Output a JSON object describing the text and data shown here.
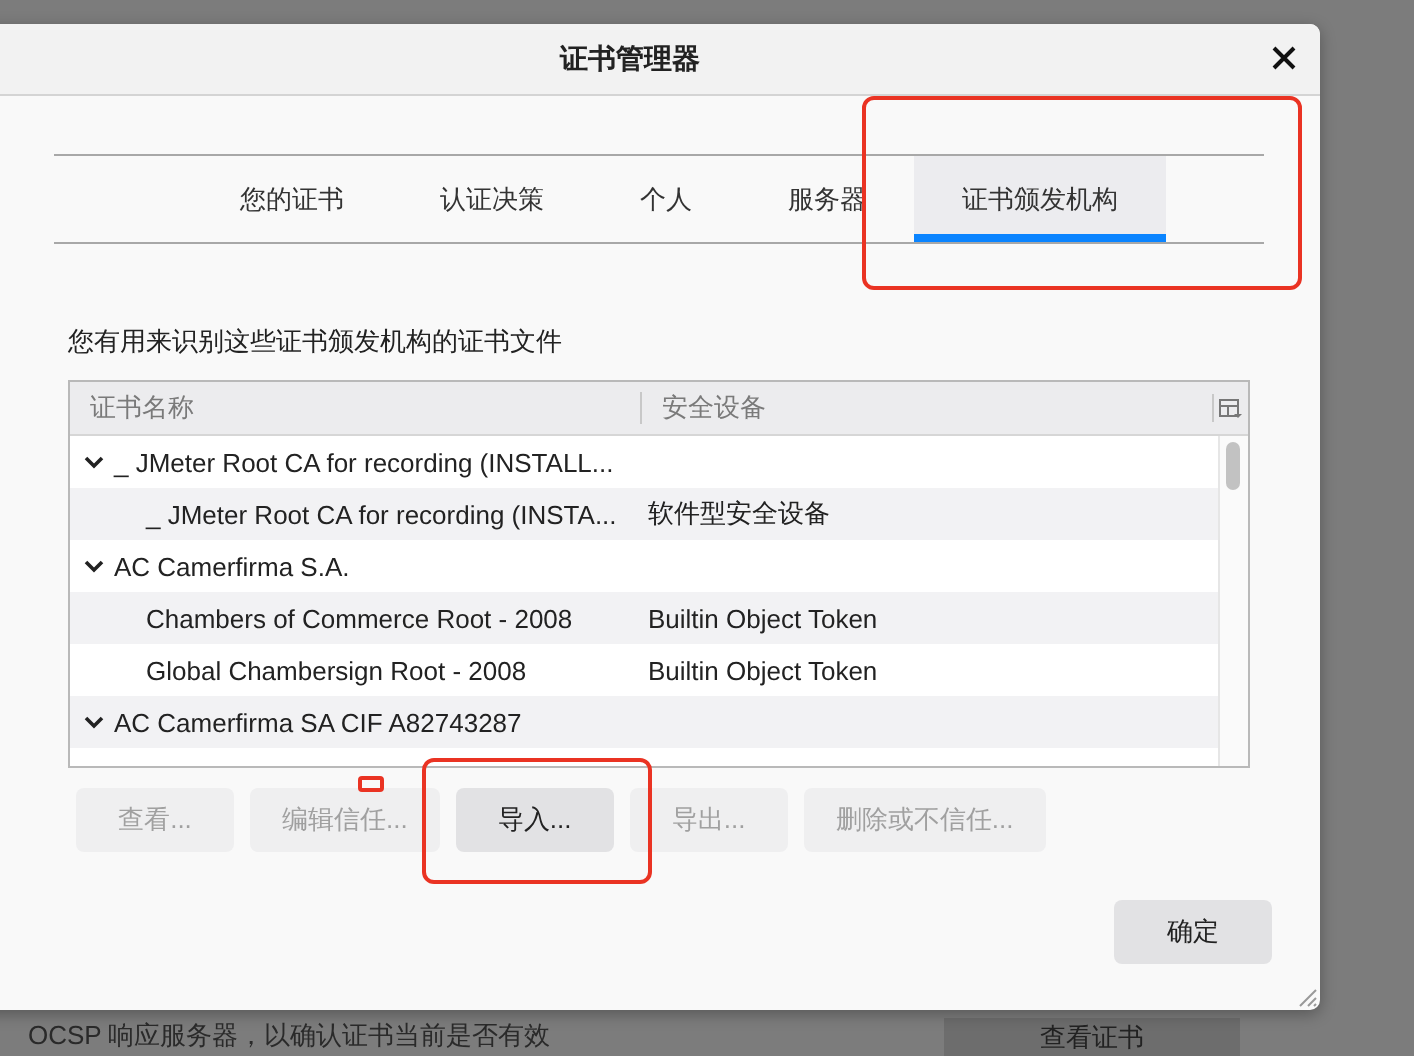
{
  "background": {
    "bottom_text": "OCSP 响应服务器，以确认证书当前是否有效",
    "bottom_button": "查看证书"
  },
  "window": {
    "title": "证书管理器"
  },
  "tabs": [
    {
      "label": "您的证书",
      "selected": false
    },
    {
      "label": "认证决策",
      "selected": false
    },
    {
      "label": "个人",
      "selected": false
    },
    {
      "label": "服务器",
      "selected": false
    },
    {
      "label": "证书颁发机构",
      "selected": true,
      "annotated": true
    }
  ],
  "description": "您有用来识别这些证书颁发机构的证书文件",
  "tree": {
    "columns": [
      "证书名称",
      "安全设备"
    ],
    "rows": [
      {
        "name": "_ JMeter Root CA for recording (INSTALL...",
        "expanded": true,
        "children": [
          {
            "name": "_ JMeter Root CA for recording (INSTA...",
            "device": "软件型安全设备"
          }
        ]
      },
      {
        "name": "AC Camerfirma S.A.",
        "expanded": true,
        "children": [
          {
            "name": "Chambers of Commerce Root - 2008",
            "device": "Builtin Object Token"
          },
          {
            "name": "Global Chambersign Root - 2008",
            "device": "Builtin Object Token"
          }
        ]
      },
      {
        "name": "AC Camerfirma SA CIF A82743287",
        "expanded": true,
        "children": []
      }
    ]
  },
  "buttons": [
    {
      "label": "查看...",
      "disabled": true
    },
    {
      "label": "编辑信任...",
      "disabled": true,
      "marker": true
    },
    {
      "label": "导入...",
      "disabled": false,
      "annotated": true
    },
    {
      "label": "导出...",
      "disabled": true
    },
    {
      "label": "删除或不信任...",
      "disabled": true
    }
  ],
  "ok_button": "确定"
}
